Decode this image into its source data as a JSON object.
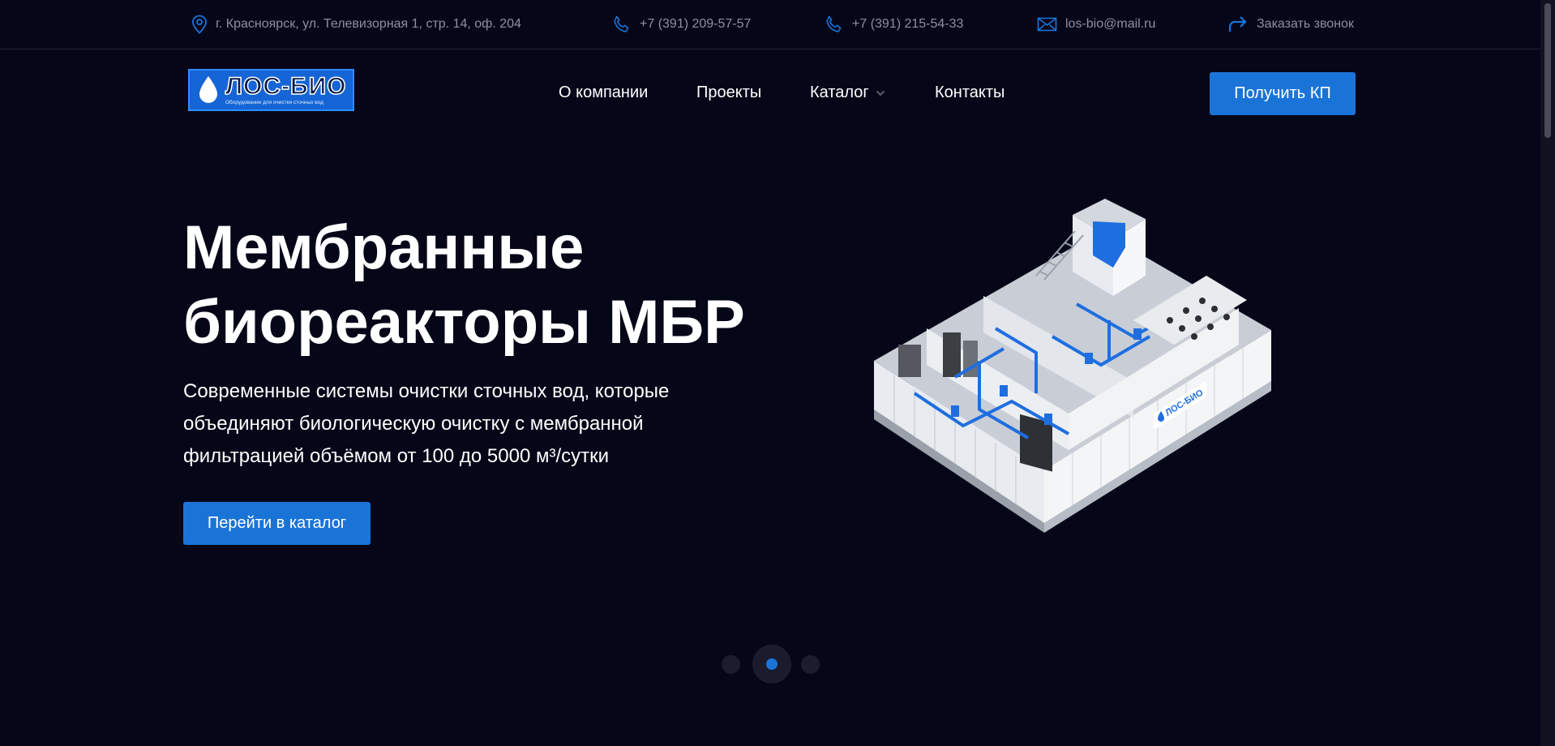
{
  "topbar": {
    "address": "г. Красноярск, ул. Телевизорная 1, стр. 14, оф. 204",
    "phone1": "+7 (391) 209-57-57",
    "phone2": "+7 (391) 215-54-33",
    "email": "los-bio@mail.ru",
    "callback": "Заказать звонок"
  },
  "logo": {
    "name": "ЛОС-БИО",
    "tagline": "Оборудование для очистки сточных вод"
  },
  "nav": {
    "about": "О компании",
    "projects": "Проекты",
    "catalog": "Каталог",
    "contacts": "Контакты"
  },
  "header": {
    "cta_label": "Получить КП"
  },
  "hero": {
    "title_line1": "Мембранные",
    "title_line2": "биореакторы МБР",
    "desc_line1": "Современные системы очистки сточных вод, которые",
    "desc_line2": "объединяют биологическую очистку с мембранной",
    "desc_line3": "фильтрацией объёмом от 100 до 5000 м³/сутки",
    "button_label": "Перейти в каталог",
    "image_brand": "ЛОС-БИО"
  },
  "slider": {
    "slide_count": 3,
    "active_index": 1
  },
  "colors": {
    "background": "#060619",
    "accent": "#1a74d8",
    "muted_text": "#8d8fa3"
  },
  "icons": {
    "address": "map-pin-icon",
    "phone": "phone-icon",
    "email": "envelope-icon",
    "callback": "reply-arrow-icon",
    "dropdown": "chevron-down-icon",
    "logo": "water-drop-icon"
  }
}
